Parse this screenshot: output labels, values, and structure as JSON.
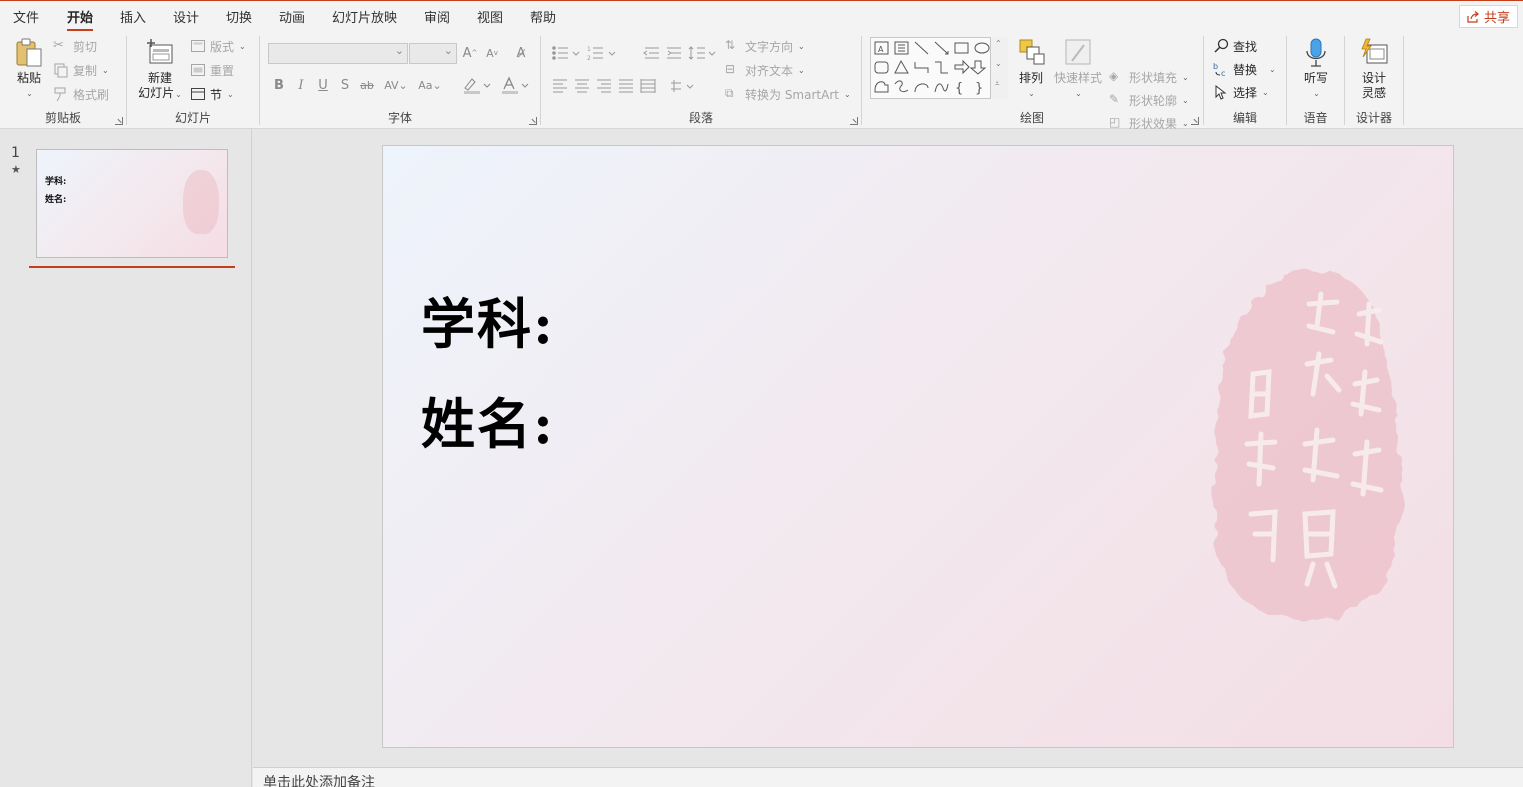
{
  "menu": {
    "tabs": [
      {
        "label": "文件"
      },
      {
        "label": "开始"
      },
      {
        "label": "插入"
      },
      {
        "label": "设计"
      },
      {
        "label": "切换"
      },
      {
        "label": "动画"
      },
      {
        "label": "幻灯片放映"
      },
      {
        "label": "审阅"
      },
      {
        "label": "视图"
      },
      {
        "label": "帮助"
      }
    ],
    "active_tab": "开始",
    "share_label": "共享"
  },
  "ribbon": {
    "clipboard": {
      "label": "剪贴板",
      "paste": "粘贴",
      "cut": "剪切",
      "copy": "复制",
      "format_painter": "格式刷"
    },
    "slides": {
      "label": "幻灯片",
      "new_slide_1": "新建",
      "new_slide_2": "幻灯片",
      "layout": "版式",
      "reset": "重置",
      "section": "节"
    },
    "font": {
      "label": "字体"
    },
    "paragraph": {
      "label": "段落",
      "text_direction": "文字方向",
      "align_text": "对齐文本",
      "convert_smartart": "转换为 SmartArt"
    },
    "drawing": {
      "label": "绘图",
      "arrange": "排列",
      "quick_styles": "快速样式",
      "shape_fill": "形状填充",
      "shape_outline": "形状轮廓",
      "shape_effects": "形状效果"
    },
    "editing": {
      "label": "编辑",
      "find": "查找",
      "replace": "替换",
      "select": "选择"
    },
    "voice": {
      "label": "语音",
      "dictate": "听写"
    },
    "designer": {
      "label": "设计器",
      "design_ideas_1": "设计",
      "design_ideas_2": "灵感"
    }
  },
  "thumbnail": {
    "number": "1",
    "star": "★",
    "line1": "学科:",
    "line2": "姓名:"
  },
  "slide": {
    "line1": "学科:",
    "line2": "姓名:"
  },
  "notes": {
    "placeholder": "单击此处添加备注"
  },
  "colors": {
    "accent": "#c43e1c",
    "seal": "#e8a8b2"
  }
}
